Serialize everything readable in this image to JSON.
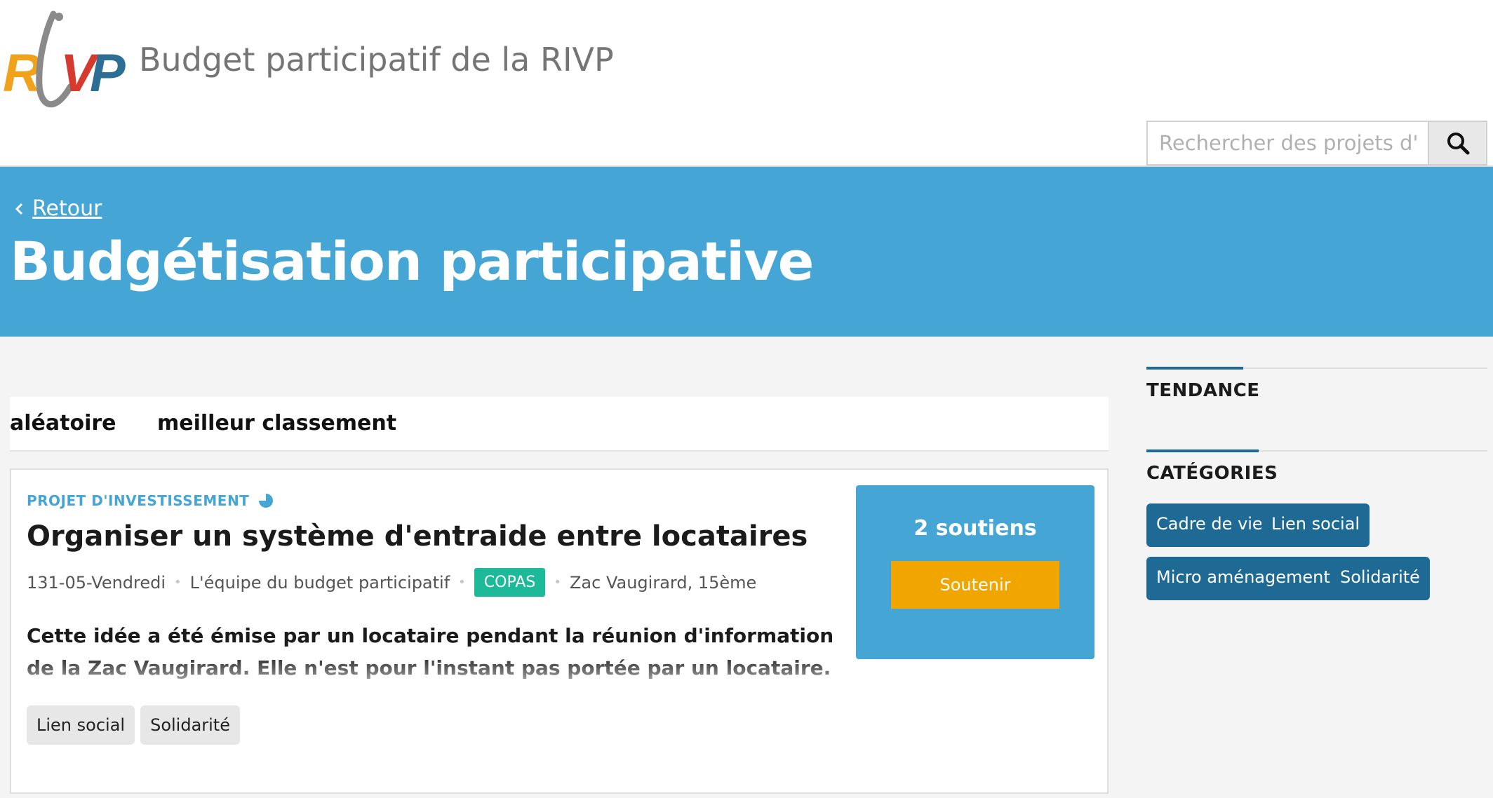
{
  "header": {
    "logo_text": "RiVP",
    "site_title": "Budget participatif de la RIVP",
    "search": {
      "placeholder": "Rechercher des projets d'inves",
      "button_icon": "search-icon"
    }
  },
  "hero": {
    "back_label": "Retour",
    "title": "Budgétisation participative"
  },
  "sort_tabs": [
    "aléatoire",
    "meilleur classement"
  ],
  "project": {
    "type_label": "PROJET D'INVESTISSEMENT",
    "type_icon": "pie-chart-icon",
    "title": "Organiser un système d'entraide entre locataires",
    "meta": {
      "date": "131-05-Vendredi",
      "author": "L'équipe du budget participatif",
      "badge": "COPAS",
      "location": "Zac Vaugirard, 15ème"
    },
    "description": "Cette idée a été émise par un locataire pendant la réunion d'information de la Zac Vaugirard. Elle n'est pour l'instant pas portée par un locataire. Si vous êtes",
    "tags": [
      "Lien social",
      "Solidarité"
    ],
    "supports": {
      "count_label": "2 soutiens",
      "button_label": "Soutenir"
    }
  },
  "sidebar": {
    "trend_heading": "TENDANCE",
    "categories_heading": "CATÉGORIES",
    "categories": [
      "Cadre de vie",
      "Lien social",
      "Micro aménagements",
      "Solidarité"
    ]
  },
  "colors": {
    "hero_blue": "#45a5d4",
    "category_blue": "#1f6a94",
    "support_orange": "#f0a500",
    "badge_green": "#1dba9a"
  }
}
